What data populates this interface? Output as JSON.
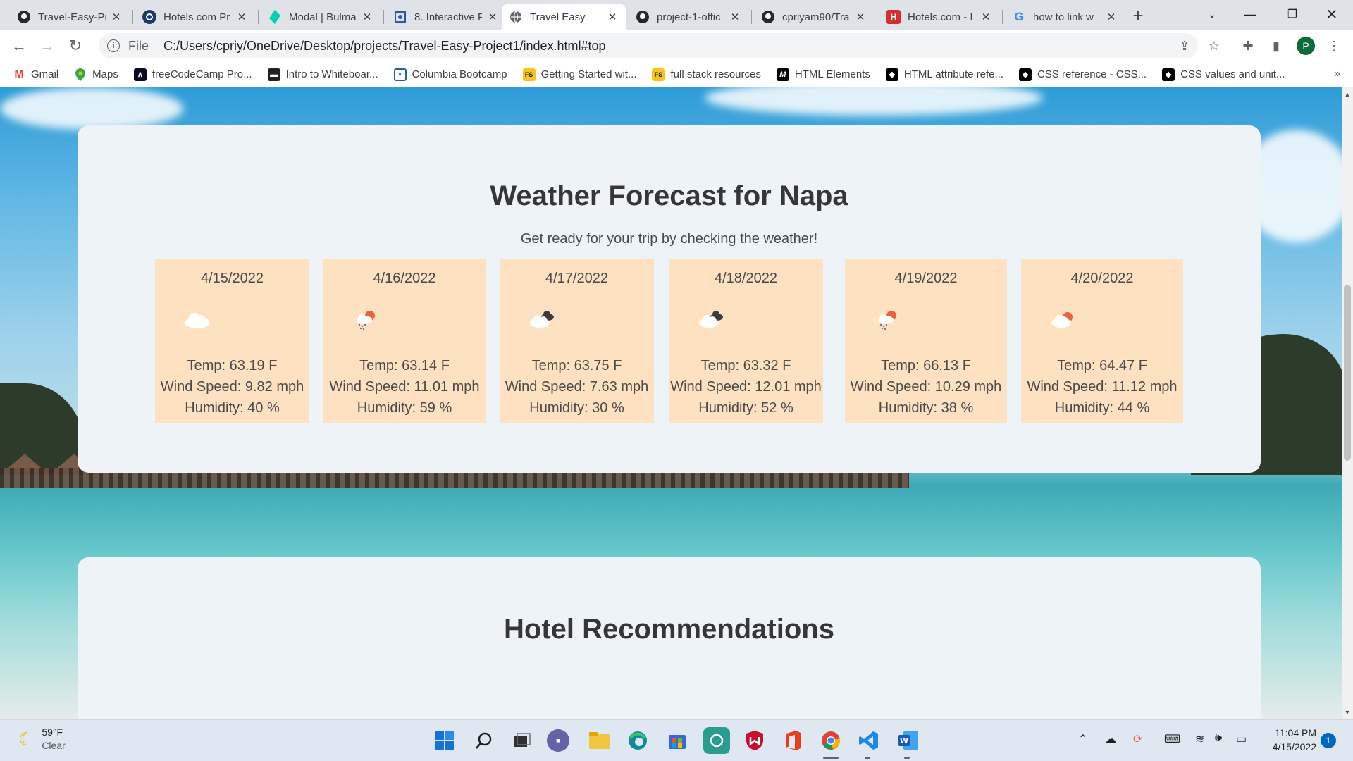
{
  "browser": {
    "tabs": [
      {
        "title": "Travel-Easy-Pr",
        "icon": "github-icon",
        "active": false
      },
      {
        "title": "Hotels com Pr",
        "icon": "rapidapi-icon",
        "active": false
      },
      {
        "title": "Modal | Bulma",
        "icon": "bulma-icon",
        "active": false
      },
      {
        "title": "8. Interactive F",
        "icon": "bootcamp-icon",
        "active": false
      },
      {
        "title": "Travel Easy",
        "icon": "globe-icon",
        "active": true
      },
      {
        "title": "project-1-offic",
        "icon": "github-icon",
        "active": false
      },
      {
        "title": "cpriyam90/Tra",
        "icon": "github-icon",
        "active": false
      },
      {
        "title": "Hotels.com - I",
        "icon": "hotels-icon",
        "active": false
      },
      {
        "title": "how to link w",
        "icon": "google-icon",
        "active": false
      }
    ],
    "address": {
      "scheme": "File",
      "url": "C:/Users/cpriy/OneDrive/Desktop/projects/Travel-Easy-Project1/index.html#top"
    },
    "avatar_letter": "P",
    "bookmarks": [
      {
        "label": "Gmail",
        "icon": "gmail-icon"
      },
      {
        "label": "Maps",
        "icon": "maps-icon"
      },
      {
        "label": "freeCodeCamp Pro...",
        "icon": "freecodecamp-icon"
      },
      {
        "label": "Intro to Whiteboar...",
        "icon": "book-icon"
      },
      {
        "label": "Columbia Bootcamp",
        "icon": "bootcamp-icon"
      },
      {
        "label": "Getting Started wit...",
        "icon": "fs-icon"
      },
      {
        "label": "full stack resources",
        "icon": "fs-icon"
      },
      {
        "label": "HTML Elements",
        "icon": "mdn-icon"
      },
      {
        "label": "HTML attribute refe...",
        "icon": "w3-icon"
      },
      {
        "label": "CSS reference - CSS...",
        "icon": "w3-icon"
      },
      {
        "label": "CSS values and unit...",
        "icon": "w3-icon"
      }
    ]
  },
  "page": {
    "weather": {
      "title": "Weather Forecast for Napa",
      "subtitle": "Get ready for your trip by checking the weather!",
      "days": [
        {
          "date": "4/15/2022",
          "icon": "cloud-icon",
          "temp": "Temp: 63.19 F",
          "wind": "Wind Speed: 9.82 mph",
          "humidity": "Humidity: 40 %"
        },
        {
          "date": "4/16/2022",
          "icon": "sun-rain-icon",
          "temp": "Temp: 63.14 F",
          "wind": "Wind Speed: 11.01 mph",
          "humidity": "Humidity: 59 %"
        },
        {
          "date": "4/17/2022",
          "icon": "dark-clouds-icon",
          "temp": "Temp: 63.75 F",
          "wind": "Wind Speed: 7.63 mph",
          "humidity": "Humidity: 30 %"
        },
        {
          "date": "4/18/2022",
          "icon": "dark-clouds-icon",
          "temp": "Temp: 63.32 F",
          "wind": "Wind Speed: 12.01 mph",
          "humidity": "Humidity: 52 %"
        },
        {
          "date": "4/19/2022",
          "icon": "sun-rain-icon",
          "temp": "Temp: 66.13 F",
          "wind": "Wind Speed: 10.29 mph",
          "humidity": "Humidity: 38 %"
        },
        {
          "date": "4/20/2022",
          "icon": "sun-cloud-icon",
          "temp": "Temp: 64.47 F",
          "wind": "Wind Speed: 11.12 mph",
          "humidity": "Humidity: 44 %"
        }
      ]
    },
    "hotels": {
      "title": "Hotel Recommendations"
    }
  },
  "taskbar": {
    "weather": {
      "temp": "59°F",
      "condition": "Clear"
    },
    "clock": {
      "time": "11:04 PM",
      "date": "4/15/2022"
    },
    "notifications": "1"
  }
}
